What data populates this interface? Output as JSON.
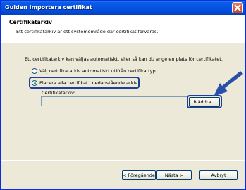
{
  "window": {
    "title": "Guiden Importera certifikat"
  },
  "header": {
    "title": "Certifikatarkiv",
    "subtitle": "Ett certifikatarkiv är ett systemområde där certifikat förvaras."
  },
  "content": {
    "intro": "Ett certifikatarkiv kan väljas automatiskt, eller så kan du ange en plats för certifikatet.",
    "option_auto": "Välj certifikatarkiv automatiskt utifrån certifikattyp",
    "option_manual": "Placera alla certifikat i nedanstående arkiv",
    "store_label": "Certifikatarkiv:",
    "store_value": "",
    "browse_button": "Bläddra..."
  },
  "footer": {
    "back_button": "< Föregående",
    "next_button": "Nästa >",
    "cancel_button": "Avbryt"
  },
  "colors": {
    "titlebar": "#0454e0",
    "highlight": "#1d3e9a",
    "arrow": "#2a4fa8"
  }
}
